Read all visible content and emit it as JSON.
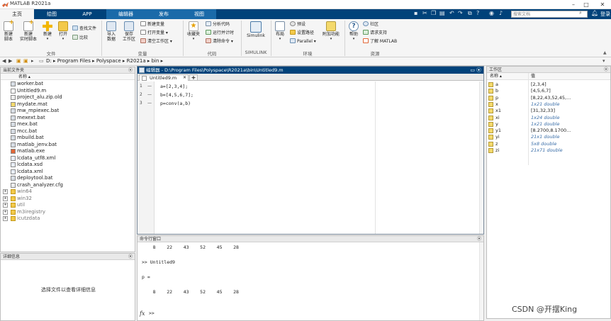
{
  "window": {
    "title": "MATLAB R2021a"
  },
  "tabs": [
    {
      "label": "主页"
    },
    {
      "label": "绘图"
    },
    {
      "label": "APP"
    },
    {
      "label": "编辑器"
    },
    {
      "label": "发布"
    },
    {
      "label": "视图"
    }
  ],
  "search": {
    "placeholder": "搜索文档"
  },
  "login": "登录",
  "ribbon": {
    "new_script": "新建\n脚本",
    "new_live_script": "新建\n实时脚本",
    "new": "新建",
    "open": "打开",
    "find_files": "查找文件",
    "compare": "比较",
    "file_group": "文件",
    "import_data": "导入\n数据",
    "save_workspace": "保存\n工作区",
    "new_variable": "新建变量",
    "open_variable": "打开变量",
    "clear_workspace": "清空工作区",
    "variable_group": "变量",
    "favorites": "收藏夹",
    "analyze_code": "分析代码",
    "run_and_time": "运行并计时",
    "clear_commands": "清除命令",
    "code_group": "代码",
    "simulink": "Simulink",
    "simulink_group": "SIMULINK",
    "layout": "布局",
    "preferences": "预设",
    "set_path": "设置路径",
    "parallel": "Parallel",
    "add_ons": "附加功能",
    "environment_group": "环境",
    "help": "帮助",
    "community": "社区",
    "request_support": "请求支持",
    "learn_matlab": "了解 MATLAB",
    "resources_group": "资源"
  },
  "address": {
    "path": [
      "D:",
      "Program Files",
      "Polyspace",
      "R2021a",
      "bin"
    ]
  },
  "file_browser": {
    "title": "当前文件夹",
    "column_name": "名称 ▴",
    "files": [
      {
        "name": "worker.bat",
        "icon": "bat-file-icon"
      },
      {
        "name": "Untitled9.m",
        "icon": "m-file-icon"
      },
      {
        "name": "project_alu.zip.old",
        "icon": "file-icon"
      },
      {
        "name": "mydate.mat",
        "icon": "mat-file-icon"
      },
      {
        "name": "mw_mpiexec.bat",
        "icon": "bat-file-icon"
      },
      {
        "name": "mexext.bat",
        "icon": "bat-file-icon"
      },
      {
        "name": "mex.bat",
        "icon": "bat-file-icon"
      },
      {
        "name": "mcc.bat",
        "icon": "bat-file-icon"
      },
      {
        "name": "mbuild.bat",
        "icon": "bat-file-icon"
      },
      {
        "name": "matlab_jenv.bat",
        "icon": "bat-file-icon"
      },
      {
        "name": "matlab.exe",
        "icon": "matlab-exe-icon"
      },
      {
        "name": "lcdata_utf8.xml",
        "icon": "xml-file-icon"
      },
      {
        "name": "lcdata.xsd",
        "icon": "xsd-file-icon"
      },
      {
        "name": "lcdata.xml",
        "icon": "xml-file-icon"
      },
      {
        "name": "deploytool.bat",
        "icon": "bat-file-icon"
      },
      {
        "name": "crash_analyzer.cfg",
        "icon": "cfg-file-icon"
      }
    ],
    "folders": [
      {
        "name": "win64"
      },
      {
        "name": "win32"
      },
      {
        "name": "util"
      },
      {
        "name": "m3iregistry"
      },
      {
        "name": "icutzdata"
      }
    ]
  },
  "details": {
    "title": "详细信息",
    "message": "选择文件以查看详细信息"
  },
  "editor": {
    "title": "编辑器 - D:\\Program Files\\Polyspace\\R2021a\\bin\\Untitled9.m",
    "tab": "Untitled9.m",
    "lines": [
      {
        "num": "1",
        "code": "a=[2,3,4];"
      },
      {
        "num": "2",
        "code": "b=[4,5,6,7];"
      },
      {
        "num": "3",
        "code": "p=conv(a,b)"
      }
    ]
  },
  "command_window": {
    "title": "命令行窗口",
    "lines": [
      "    8    22    43    52    45    28",
      "",
      ">> Untitled9",
      "",
      "p =",
      "",
      "    8    22    43    52    45    28"
    ],
    "prompt_symbol": "fx",
    "prompt": ">>"
  },
  "workspace": {
    "title": "工作区",
    "col_name": "名称 ▴",
    "col_value": "值",
    "vars": [
      {
        "name": "a",
        "value": "[2,3,4]",
        "italic": false
      },
      {
        "name": "b",
        "value": "[4,5,6,7]",
        "italic": false
      },
      {
        "name": "p",
        "value": "[8,22,43,52,45,...",
        "italic": false
      },
      {
        "name": "x",
        "value": "1x21 double",
        "italic": true
      },
      {
        "name": "x1",
        "value": "[31,32,33]",
        "italic": false
      },
      {
        "name": "xi",
        "value": "1x24 double",
        "italic": true
      },
      {
        "name": "y",
        "value": "1x21 double",
        "italic": true
      },
      {
        "name": "y1",
        "value": "[8.2700,8.1700...",
        "italic": false
      },
      {
        "name": "yi",
        "value": "21x1 double",
        "italic": true
      },
      {
        "name": "z",
        "value": "5x8 double",
        "italic": true
      },
      {
        "name": "zi",
        "value": "21x71 double",
        "italic": true
      }
    ]
  },
  "watermark": "CSDN @开摆King",
  "colors": {
    "tab_bar": "#00427a",
    "active_tab": "#1a6aa9",
    "accent": "#f4d96b"
  }
}
